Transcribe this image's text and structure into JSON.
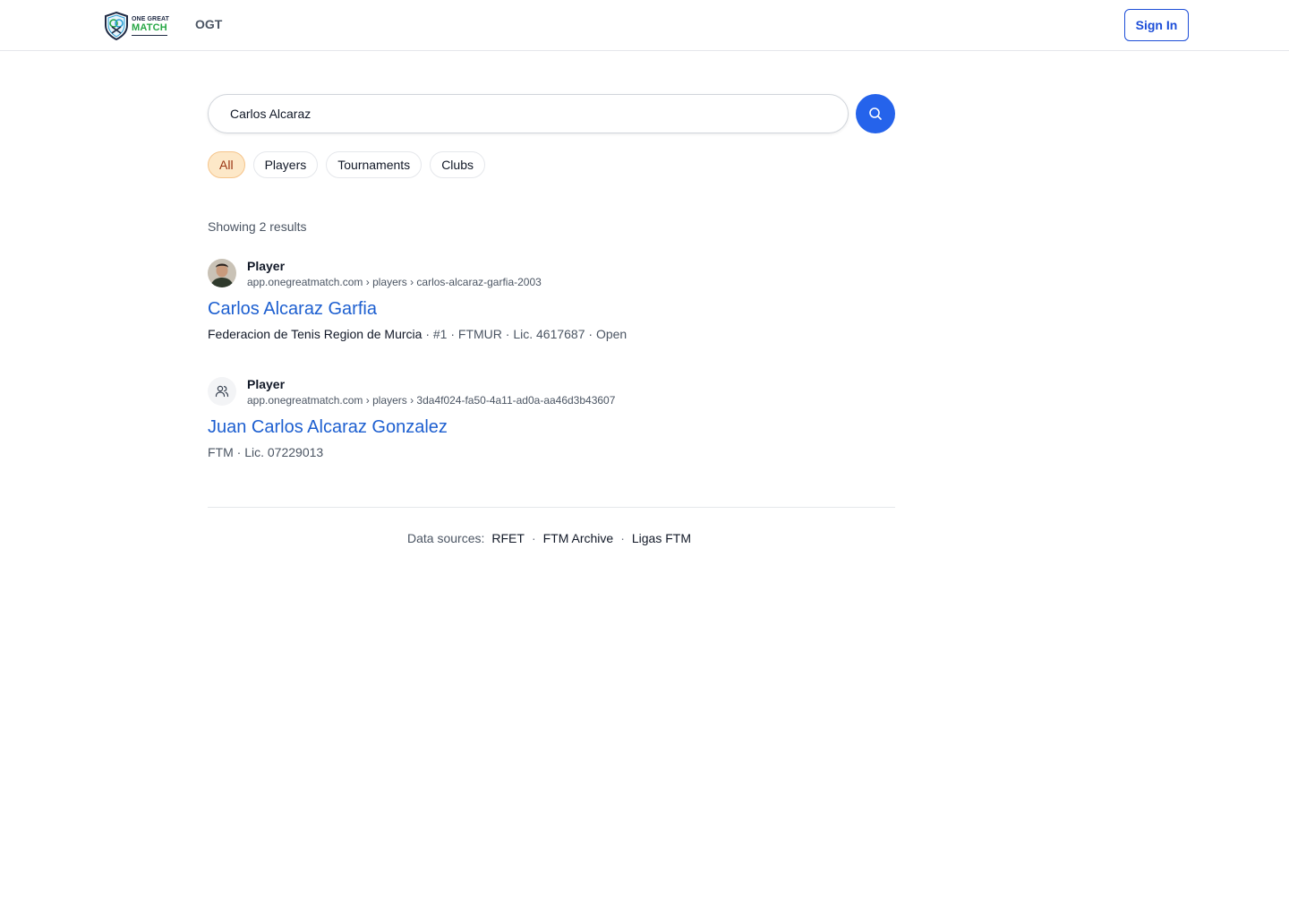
{
  "header": {
    "logo_top": "ONE GREAT",
    "logo_bottom": "MATCH",
    "nav_label": "OGT",
    "signin_label": "Sign In"
  },
  "search": {
    "value": "Carlos Alcaraz",
    "button_icon": "search-icon"
  },
  "filters": {
    "all": "All",
    "players": "Players",
    "tournaments": "Tournaments",
    "clubs": "Clubs",
    "active": "All"
  },
  "results_summary": "Showing 2 results",
  "results": [
    {
      "type": "Player",
      "url": "app.onegreatmatch.com › players › carlos-alcaraz-garfia-2003",
      "title": "Carlos Alcaraz Garfia",
      "meta_primary": "Federacion de Tenis Region de Murcia",
      "meta_rest": " · #1 · FTMUR · Lic. 4617687 · Open",
      "avatar": "player-photo"
    },
    {
      "type": "Player",
      "url": "app.onegreatmatch.com › players › 3da4f024-fa50-4a11-ad0a-aa46d3b43607",
      "title": "Juan Carlos Alcaraz Gonzalez",
      "meta": "FTM · Lic. 07229013",
      "avatar": "users-icon"
    }
  ],
  "footer": {
    "label": "Data sources:",
    "sources": [
      "RFET",
      "FTM Archive",
      "Ligas FTM"
    ],
    "separator": "·"
  },
  "colors": {
    "accent": "#2563eb",
    "link": "#1d5fd0",
    "active_chip_bg": "#fde8c8",
    "active_chip_text": "#9a3412",
    "logo_green": "#27a745"
  }
}
